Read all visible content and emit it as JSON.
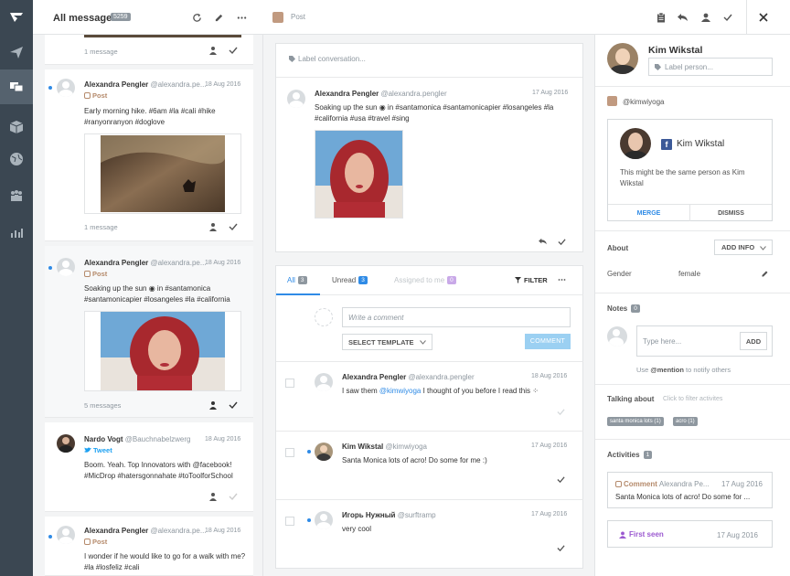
{
  "rail": {
    "icons": [
      "logo-icon",
      "send-icon",
      "chat-icon",
      "box-icon",
      "globe-icon",
      "people-icon",
      "chart-icon"
    ],
    "active": 2
  },
  "messages": {
    "title": "All messages",
    "count": "5259",
    "items": [
      {
        "footer": "1 message"
      },
      {
        "name": "Alexandra Pengler",
        "handle": "@alexandra.pe...",
        "date": "18 Aug 2016",
        "channel": "Post",
        "text": "Early morning hike. #6am #la #cali #hike #ranyonranyon #doglove",
        "footer": "1 message",
        "unread": true
      },
      {
        "name": "Alexandra Pengler",
        "handle": "@alexandra.pe...",
        "date": "18 Aug 2016",
        "channel": "Post",
        "text": "Soaking up the sun ◉ in #santamonica #santamonicapier #losangeles #la #california",
        "footer": "5 messages",
        "unread": true
      },
      {
        "name": "Nardo Vogt",
        "handle": "@Bauchnabelzwerg",
        "date": "18 Aug 2016",
        "channel": "Tweet",
        "text": "Boom. Yeah. Top Innovators with @facebook! #MicDrop #hatersgonnahate #toToolforSchool"
      },
      {
        "name": "Alexandra Pengler",
        "handle": "@alexandra.pe...",
        "date": "18 Aug 2016",
        "channel": "Post",
        "text": "I wonder if he would like to go for a walk with me? #la #losfeliz #cali",
        "unread": true
      }
    ]
  },
  "conversation": {
    "channel": "Post",
    "label_placeholder": "Label conversation...",
    "post": {
      "name": "Alexandra Pengler",
      "handle": "@alexandra.pengler",
      "date": "17 Aug 2016",
      "text": "Soaking up the sun ◉ in #santamonica #santamonicapier #losangeles #la #california #usa #travel #sing"
    },
    "tabs": [
      {
        "label": "All",
        "count": "3"
      },
      {
        "label": "Unread",
        "count": "3"
      },
      {
        "label": "Assigned to me",
        "count": "0"
      }
    ],
    "filter_label": "FILTER",
    "comment_placeholder": "Write a comment",
    "select_template": "SELECT TEMPLATE",
    "comment_button": "COMMENT",
    "comments": [
      {
        "name": "Alexandra Pengler",
        "handle": "@alexandra.pengler",
        "date": "18 Aug 2016",
        "pre": "I saw them ",
        "mention": "@kimwiyoga",
        "post": " I thought of you before I read this ⁘"
      },
      {
        "name": "Kim Wikstal",
        "handle": "@kimwiyoga",
        "date": "17 Aug 2016",
        "pre": "Santa Monica lots of acro! Do some for me :)",
        "mention": "",
        "post": "",
        "unread": true
      },
      {
        "name": "Игорь Нужный",
        "handle": "@surftramp",
        "date": "17 Aug 2016",
        "pre": "very cool",
        "mention": "",
        "post": "",
        "unread": true
      }
    ]
  },
  "profile": {
    "name": "Kim Wikstal",
    "label_placeholder": "Label person...",
    "ig_handle": "@kimwiyoga",
    "match": {
      "name": "Kim Wikstal",
      "text": "This might be the same person as Kim Wikstal",
      "merge": "MERGE",
      "dismiss": "DISMISS"
    },
    "about": {
      "title": "About",
      "add_info": "ADD INFO",
      "gender_label": "Gender",
      "gender_value": "female"
    },
    "notes": {
      "title": "Notes",
      "count": "0",
      "placeholder": "Type here...",
      "add": "ADD",
      "hint_pre": "Use ",
      "hint_mention": "@mention",
      "hint_post": " to notify others"
    },
    "talking": {
      "title": "Talking about",
      "hint": "Click to filter activites",
      "tags": [
        "santa monica lots (1)",
        "acro (1)"
      ]
    },
    "activities": {
      "title": "Activities",
      "count": "1",
      "comment": {
        "type": "Comment",
        "name": "Alexandra Pe...",
        "date": "17 Aug 2016",
        "text": "Santa Monica lots of acro! Do some for ..."
      },
      "first_seen": {
        "label": "First seen",
        "date": "17 Aug 2016"
      }
    }
  },
  "colors": {
    "accent": "#2f8be6",
    "rail": "#3b4752",
    "instagram": "#b58a6b",
    "twitter": "#1da1f2",
    "purple": "#9b59d0"
  }
}
